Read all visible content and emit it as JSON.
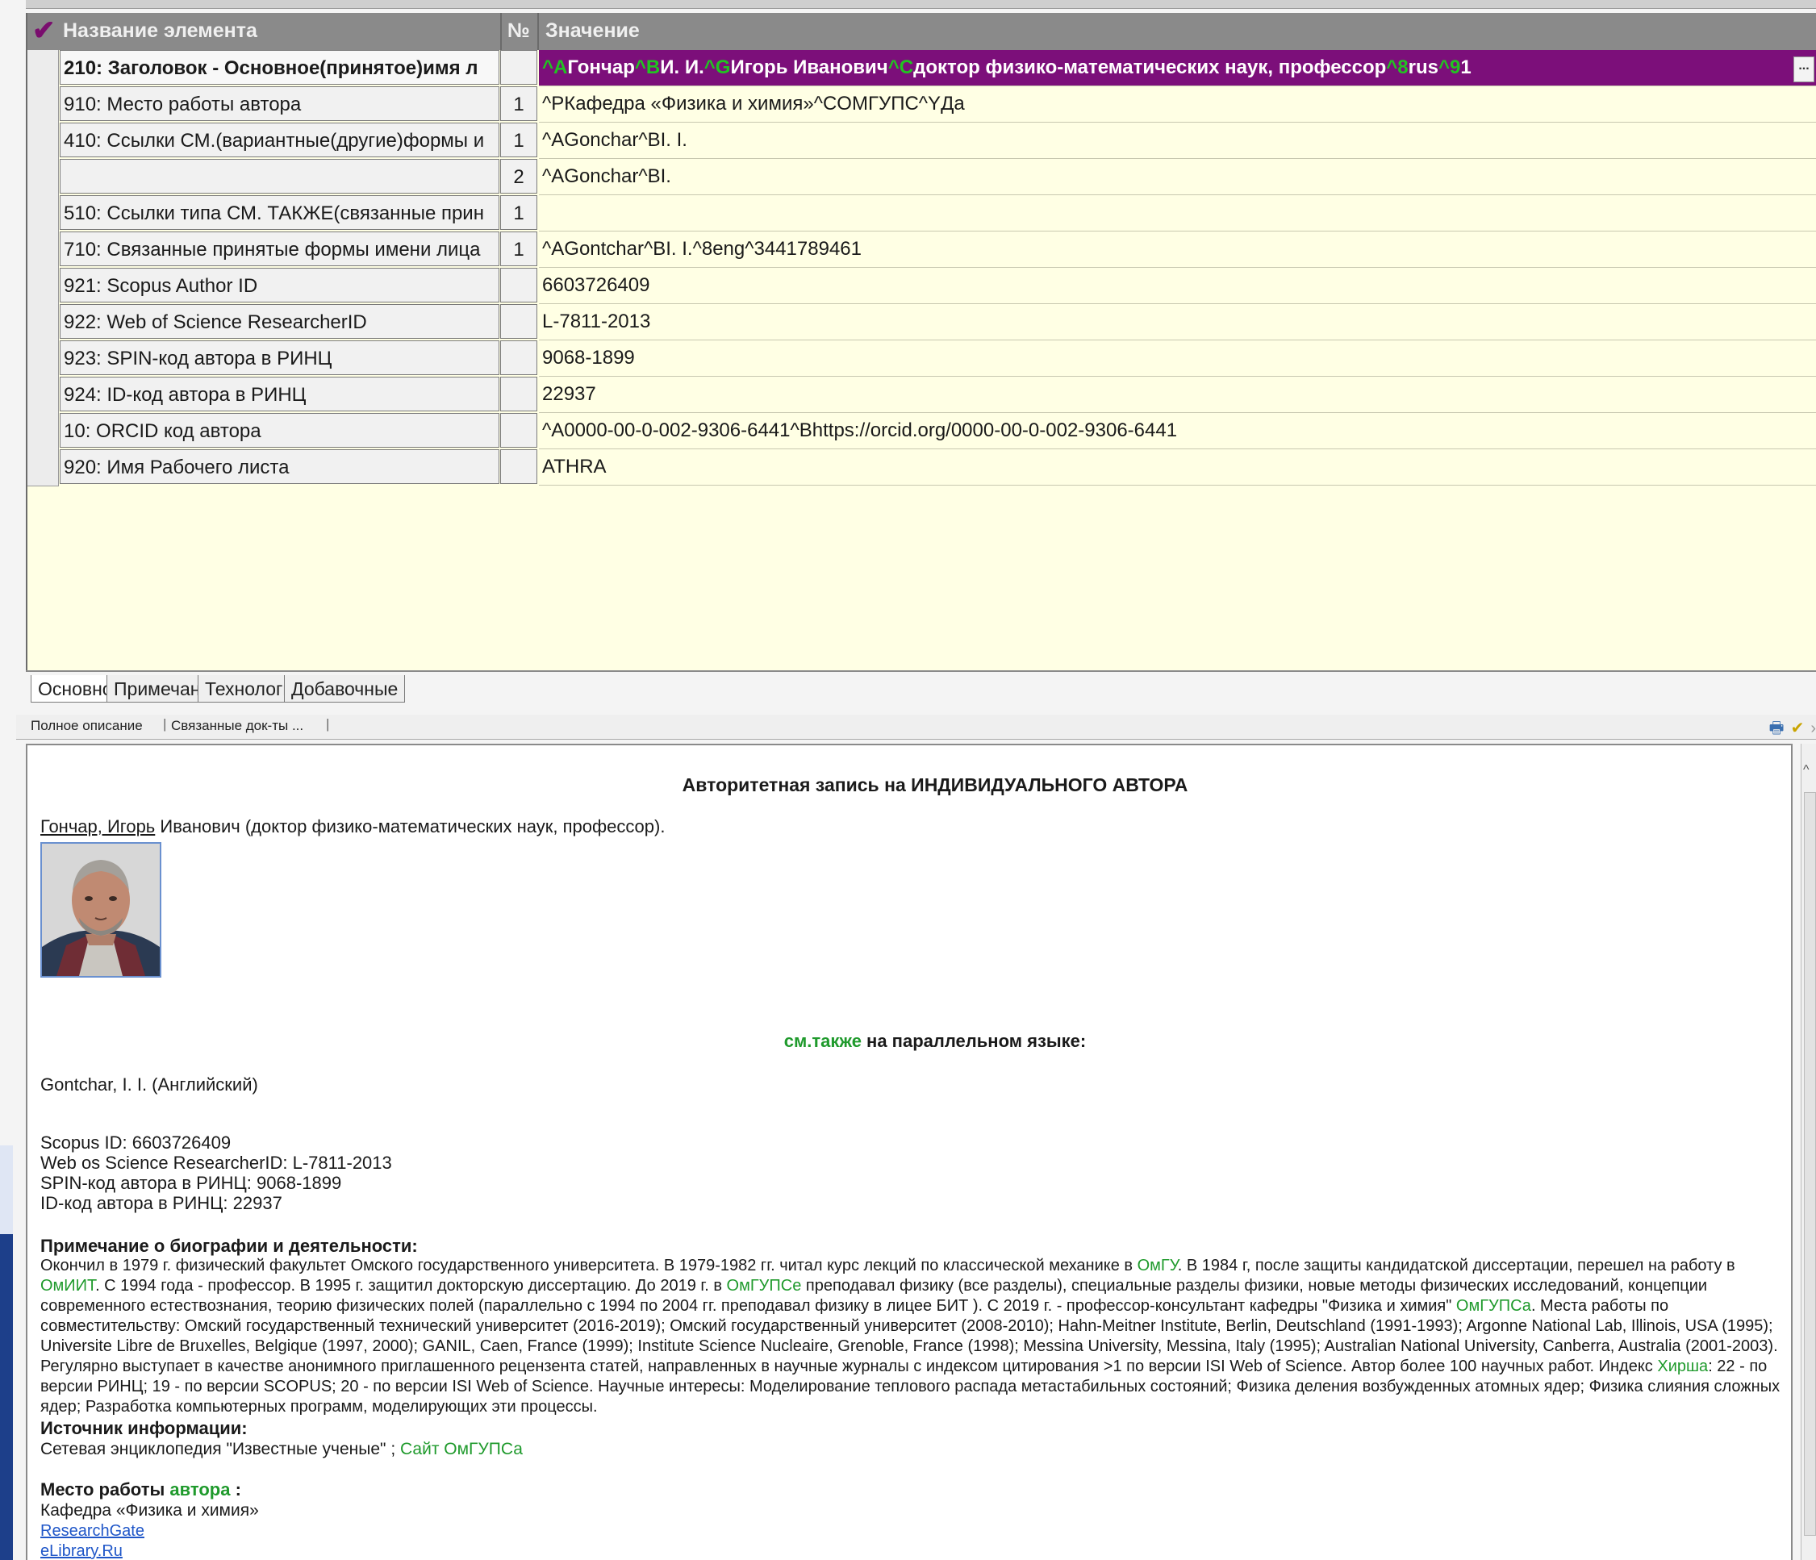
{
  "grid": {
    "headers": {
      "name": "Название элемента",
      "num": "№",
      "value": "Значение"
    },
    "rows": [
      {
        "name": "210: Заголовок - Основное(принятое)имя л",
        "num": "",
        "value": "Гончар",
        "value_parts": [
          "^A",
          "Гончар",
          "^B",
          "И. И.",
          "^G",
          "Игорь Иванович",
          "^C",
          "доктор физико-математических наук, профессор",
          "^8",
          "rus",
          "^9",
          "1"
        ]
      },
      {
        "name": "910: Место работы автора",
        "num": "1",
        "value": "^PКафедра «Физика и химия»^CОМГУПС^YДа"
      },
      {
        "name": "410: Ссылки СМ.(вариантные(другие)формы и",
        "num": "1",
        "value": "^AGonchar^BI. I."
      },
      {
        "name": "",
        "num": "2",
        "value": "^AGonchar^BI."
      },
      {
        "name": "510: Ссылки типа СМ. ТАКЖЕ(связанные прин",
        "num": "1",
        "value": ""
      },
      {
        "name": "710: Связанные принятые формы имени лица",
        "num": "1",
        "value": "^AGontchar^BI. I.^8eng^3441789461"
      },
      {
        "name": "921: Scopus Author ID",
        "num": "",
        "value": "6603726409"
      },
      {
        "name": "922: Web of Science ResearcherID",
        "num": "",
        "value": "L-7811-2013"
      },
      {
        "name": "923: SPIN-код автора в РИНЦ",
        "num": "",
        "value": "9068-1899"
      },
      {
        "name": "924: ID-код автора в РИНЦ",
        "num": "",
        "value": "22937"
      },
      {
        "name": "10: ORCID код автора",
        "num": "",
        "value": "^A0000-00-0-002-9306-6441^Bhttps://orcid.org/0000-00-0-002-9306-6441"
      },
      {
        "name": "920: Имя Рабочего листа",
        "num": "",
        "value": "ATHRA"
      }
    ],
    "ellipsis_button": "..."
  },
  "tabs": [
    "Основное",
    "Примечания",
    "Технология",
    "Добавочные"
  ],
  "subtabs": [
    "Полное описание",
    "Связанные док-ты ..."
  ],
  "document": {
    "title": "Авторитетная запись на ИНДИВИДУАЛЬНОГО АВТОРА",
    "author_link": "Гончар, Игорь",
    "author_rest": " Иванович (доктор физико-математических наук, профессор).",
    "seealso_green": "см.также",
    "seealso_rest": " на параллельном языке:",
    "parallel_name": "Gontchar, I. I. (Английский)",
    "ids": [
      "Scopus ID: 6603726409",
      "Web os Science ResearcherID: L-7811-2013",
      "SPIN-код автора в РИНЦ: 9068-1899",
      "ID-код автора в РИНЦ: 22937"
    ],
    "bio_heading": "Примечание о биографии и деятельности:",
    "bio": [
      {
        "t": "Окончил в 1979 г. физический факультет Омского государственного университета. В 1979-1982 гг. читал курс лекций по классической механике в "
      },
      {
        "t": "ОмГУ",
        "g": true
      },
      {
        "t": ". В 1984 г, после защиты кандидатской диссертации, перешел на работу в "
      },
      {
        "t": "ОмИИТ",
        "g": true
      },
      {
        "t": ". С 1994 года - профессор. В 1995 г. защитил докторскую диссертацию. До 2019 г. в "
      },
      {
        "t": "ОмГУПСе",
        "g": true
      },
      {
        "t": " преподавал физику (все разделы), специальные разделы физики, новые методы физических исследований, концепции современного естествознания, теорию физических полей (параллельно с 1994 по 2004 гг. преподавал физику в лицее БИТ ). С 2019 г. - профессор-консультант кафедры \"Физика и химия\" "
      },
      {
        "t": "ОмГУПСа",
        "g": true
      },
      {
        "t": ". Места работы по совместительству: Омский государственный технический университет (2016-2019); Омский государственный университет (2008-2010); Hahn-Meitner Institute, Berlin, Deutschland (1991-1993); Argonne National Lab, Illinois, USA (1995); Universite Libre de Bruxelles, Belgique (1997, 2000); GANIL, Caen, France (1999); Institute Science Nucleaire, Grenoble, France (1998); Messina University, Messina, Italy (1995); Australian National University, Canberra, Australia (2001-2003). Регулярно выступает в качестве анонимного приглашенного рецензента статей, направленных в научные журналы с индексом цитирования >1 по версии ISI Web of Science. Автор более 100 научных работ. Индекс "
      },
      {
        "t": "Хирша",
        "g": true
      },
      {
        "t": ": 22 - по версии РИНЦ; 19 - по версии SCOPUS; 20 - по версии ISI Web of Science. Научные интересы: Моделирование теплового распада метастабильных состояний; Физика деления возбужденных атомных ядер; Физика слияния сложных ядер; Разработка компьютерных программ, моделирующих эти процессы."
      }
    ],
    "source_heading": "Источник информации:",
    "source_text": "Сетевая энциклопедия \"Известные ученые\" ; ",
    "source_link": "Сайт ОмГУПСа",
    "work_heading_bold": "Место работы ",
    "work_heading_green": "автора",
    "work_heading_tail": " :",
    "work_dept": "Кафедра «Физика и химия»",
    "links": [
      "ResearchGate",
      "eLibrary.Ru"
    ]
  },
  "colors": {
    "active_row": "#7c0f7a",
    "grid_bg": "#ffffe4",
    "green_text": "#1f9a2c",
    "link": "#1f56c8"
  }
}
